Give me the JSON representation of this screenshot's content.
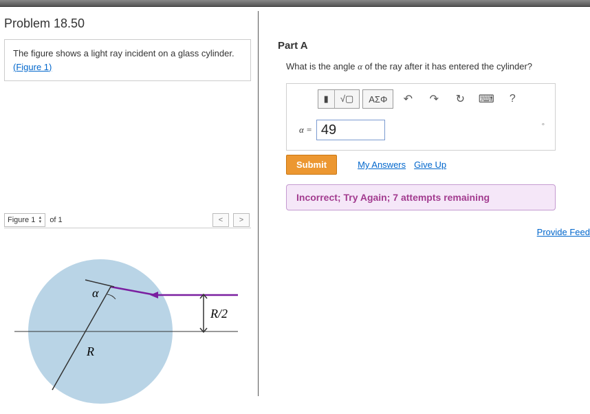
{
  "problem": {
    "title": "Problem 18.50",
    "prompt": "The figure shows a light ray incident on a glass cylinder.",
    "figure_link": "(Figure 1)"
  },
  "figure": {
    "selector_label": "Figure 1",
    "count_text": "of 1",
    "labels": {
      "alpha": "α",
      "R": "R",
      "Rhalf": "R/2"
    }
  },
  "part": {
    "label": "Part A",
    "question_pre": "What is the angle ",
    "question_var": "α",
    "question_post": " of the ray after it has entered the cylinder?"
  },
  "toolbar": {
    "template_icon": "▮",
    "fraction_icon": "√▢",
    "greek_icon": "ΑΣΦ",
    "undo_icon": "↶",
    "redo_icon": "↷",
    "reset_icon": "↻",
    "keyboard_icon": "⌨",
    "help_icon": "?"
  },
  "answer": {
    "label": "α =",
    "value": "49",
    "unit_marker": "∘"
  },
  "actions": {
    "submit": "Submit",
    "my_answers": "My Answers",
    "give_up": "Give Up"
  },
  "feedback": "Incorrect; Try Again; 7 attempts remaining",
  "footer": {
    "provide_feedback": "Provide Feed"
  }
}
